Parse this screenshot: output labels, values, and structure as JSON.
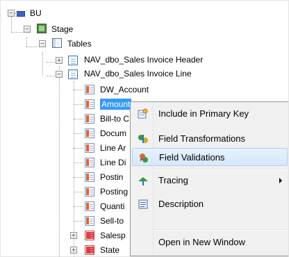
{
  "tree": {
    "bu": "BU",
    "stage": "Stage",
    "tables": "Tables",
    "header_table": "NAV_dbo_Sales Invoice Header",
    "line_table": "NAV_dbo_Sales Invoice Line",
    "fields": [
      "DW_Account",
      "Amount",
      "Bill-to C",
      "Docum",
      "Line Ar",
      "Line Di",
      "Postin",
      "Posting",
      "Quanti",
      "Sell-to",
      "Salesp",
      "State"
    ]
  },
  "context_menu": {
    "items": [
      {
        "label": "Include in Primary Key",
        "icon": "key-icon"
      },
      {
        "label": "Field Transformations",
        "icon": "transform-icon"
      },
      {
        "label": "Field Validations",
        "icon": "validation-icon"
      },
      {
        "label": "Tracing",
        "icon": "tracing-icon"
      },
      {
        "label": "Description",
        "icon": "description-icon"
      },
      {
        "label": "Open in New Window",
        "icon": ""
      }
    ],
    "highlighted": "Field Validations"
  },
  "colors": {
    "selection": "#3399ff",
    "menu_highlight": "#d7e8fa"
  }
}
